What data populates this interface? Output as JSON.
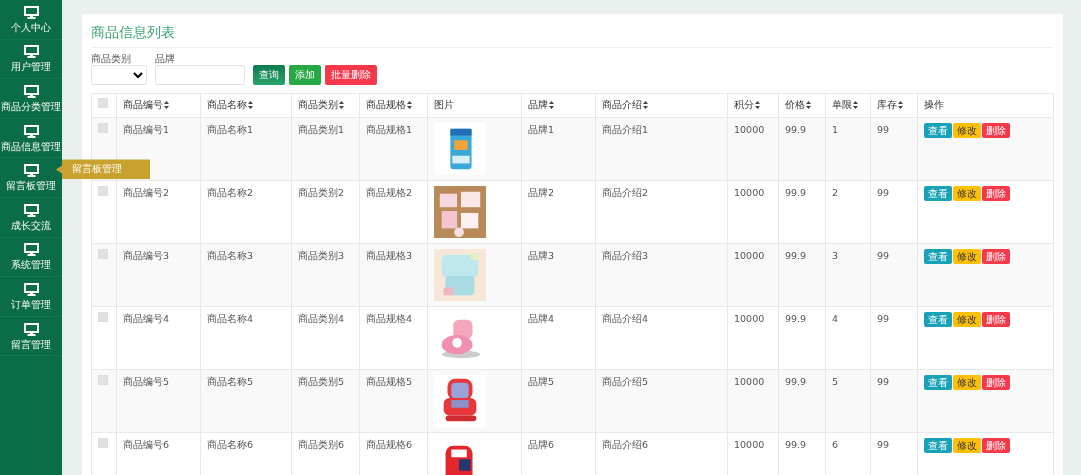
{
  "sidebar": {
    "items": [
      {
        "label": "个人中心"
      },
      {
        "label": "用户管理"
      },
      {
        "label": "商品分类管理"
      },
      {
        "label": "商品信息管理"
      },
      {
        "label": "留言板管理",
        "tooltip": "留言板管理"
      },
      {
        "label": "成长交流"
      },
      {
        "label": "系统管理"
      },
      {
        "label": "订单管理"
      },
      {
        "label": "留言管理"
      }
    ]
  },
  "page_title": "商品信息列表",
  "filters": {
    "fields": [
      {
        "kind": "select",
        "label": "商品类别"
      },
      {
        "kind": "text",
        "label": "品牌"
      }
    ],
    "buttons": [
      {
        "kind": "search",
        "label": "查询"
      },
      {
        "kind": "add",
        "label": "添加"
      },
      {
        "kind": "delete",
        "label": "批量删除"
      }
    ]
  },
  "table": {
    "select_all": {
      "checked": false
    },
    "columns": [
      {
        "label": "商品编号",
        "sortable": true
      },
      {
        "label": "商品名称",
        "sortable": true
      },
      {
        "label": "商品类别",
        "sortable": true
      },
      {
        "label": "商品规格",
        "sortable": true
      },
      {
        "label": "图片",
        "sortable": false
      },
      {
        "label": "品牌",
        "sortable": true
      },
      {
        "label": "商品介绍",
        "sortable": true
      },
      {
        "label": "积分",
        "sortable": true
      },
      {
        "label": "价格",
        "sortable": true
      },
      {
        "label": "单限",
        "sortable": true
      },
      {
        "label": "库存",
        "sortable": true
      },
      {
        "label": "操作",
        "sortable": false
      }
    ],
    "rows": [
      {
        "checked": false,
        "cells": [
          "商品编号1",
          "商品名称1",
          "商品类别1",
          "商品规格1",
          {
            "kind": "picture"
          },
          "品牌1",
          "商品介绍1",
          "10000",
          "99.9",
          "1",
          "99"
        ],
        "actions": [
          {
            "kind": "view",
            "label": "查看"
          },
          {
            "kind": "edit",
            "label": "修改"
          },
          {
            "kind": "delete",
            "label": "删除"
          }
        ]
      },
      {
        "checked": false,
        "cells": [
          "商品编号2",
          "商品名称2",
          "商品类别2",
          "商品规格2",
          {
            "kind": "picture"
          },
          "品牌2",
          "商品介绍2",
          "10000",
          "99.9",
          "2",
          "99"
        ],
        "actions": [
          {
            "kind": "view",
            "label": "查看"
          },
          {
            "kind": "edit",
            "label": "修改"
          },
          {
            "kind": "delete",
            "label": "删除"
          }
        ]
      },
      {
        "checked": false,
        "cells": [
          "商品编号3",
          "商品名称3",
          "商品类别3",
          "商品规格3",
          {
            "kind": "picture"
          },
          "品牌3",
          "商品介绍3",
          "10000",
          "99.9",
          "3",
          "99"
        ],
        "actions": [
          {
            "kind": "view",
            "label": "查看"
          },
          {
            "kind": "edit",
            "label": "修改"
          },
          {
            "kind": "delete",
            "label": "删除"
          }
        ]
      },
      {
        "checked": false,
        "cells": [
          "商品编号4",
          "商品名称4",
          "商品类别4",
          "商品规格4",
          {
            "kind": "picture"
          },
          "品牌4",
          "商品介绍4",
          "10000",
          "99.9",
          "4",
          "99"
        ],
        "actions": [
          {
            "kind": "view",
            "label": "查看"
          },
          {
            "kind": "edit",
            "label": "修改"
          },
          {
            "kind": "delete",
            "label": "删除"
          }
        ]
      },
      {
        "checked": false,
        "cells": [
          "商品编号5",
          "商品名称5",
          "商品类别5",
          "商品规格5",
          {
            "kind": "picture"
          },
          "品牌5",
          "商品介绍5",
          "10000",
          "99.9",
          "5",
          "99"
        ],
        "actions": [
          {
            "kind": "view",
            "label": "查看"
          },
          {
            "kind": "edit",
            "label": "修改"
          },
          {
            "kind": "delete",
            "label": "删除"
          }
        ]
      },
      {
        "checked": false,
        "cells": [
          "商品编号6",
          "商品名称6",
          "商品类别6",
          "商品规格6",
          {
            "kind": "picture"
          },
          "品牌6",
          "商品介绍6",
          "10000",
          "99.9",
          "6",
          "99"
        ],
        "actions": [
          {
            "kind": "view",
            "label": "查看"
          },
          {
            "kind": "edit",
            "label": "修改"
          },
          {
            "kind": "delete",
            "label": "删除"
          }
        ]
      }
    ]
  }
}
